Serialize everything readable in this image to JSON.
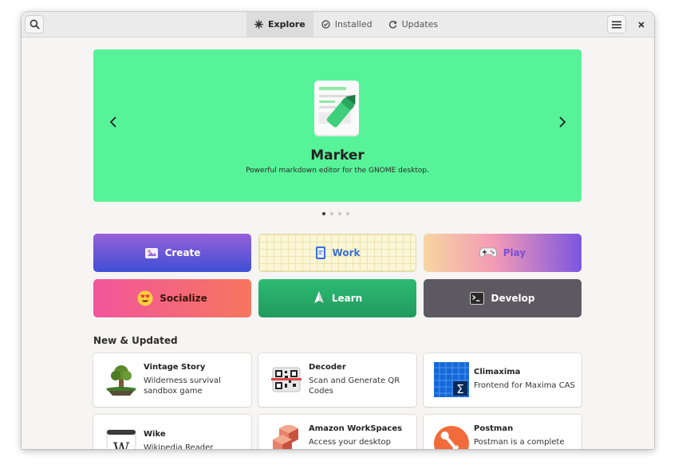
{
  "headerbar": {
    "tabs": [
      {
        "label": "Explore",
        "icon": "compass-icon",
        "active": true
      },
      {
        "label": "Installed",
        "icon": "check-circle-icon",
        "active": false
      },
      {
        "label": "Updates",
        "icon": "refresh-icon",
        "active": false
      }
    ]
  },
  "featured": {
    "title": "Marker",
    "subtitle": "Powerful markdown editor for the GNOME desktop.",
    "background": "#57f398",
    "prev_icon": "chevron-left-icon",
    "next_icon": "chevron-right-icon",
    "pages": 4,
    "current_page": 1
  },
  "categories": [
    {
      "label": "Create",
      "icon": "create-icon",
      "text_color": "#ffffff"
    },
    {
      "label": "Work",
      "icon": "work-icon",
      "text_color": "#3c6fd4"
    },
    {
      "label": "Play",
      "icon": "gamepad-icon",
      "text_color": "#7a4fd0"
    },
    {
      "label": "Socialize",
      "icon": "heart-eyes-emoji-icon",
      "text_color": "#3a1408"
    },
    {
      "label": "Learn",
      "icon": "sailboat-icon",
      "text_color": "#ffffff"
    },
    {
      "label": "Develop",
      "icon": "terminal-icon",
      "text_color": "#ffffff"
    }
  ],
  "section": {
    "title": "New & Updated"
  },
  "apps": [
    {
      "name": "Vintage Story",
      "description": "Wilderness survival sandbox game",
      "icon": "vintage-story-icon"
    },
    {
      "name": "Decoder",
      "description": "Scan and Generate QR Codes",
      "icon": "qr-code-icon"
    },
    {
      "name": "Climaxima",
      "description": "Frontend for Maxima CAS",
      "icon": "climaxima-icon"
    },
    {
      "name": "Wike",
      "description": "Wikipedia Reader",
      "icon": "wikipedia-icon"
    },
    {
      "name": "Amazon WorkSpaces",
      "description": "Access your desktop",
      "icon": "amazon-workspaces-icon"
    },
    {
      "name": "Postman",
      "description": "Postman is a complete API",
      "icon": "postman-icon"
    }
  ]
}
